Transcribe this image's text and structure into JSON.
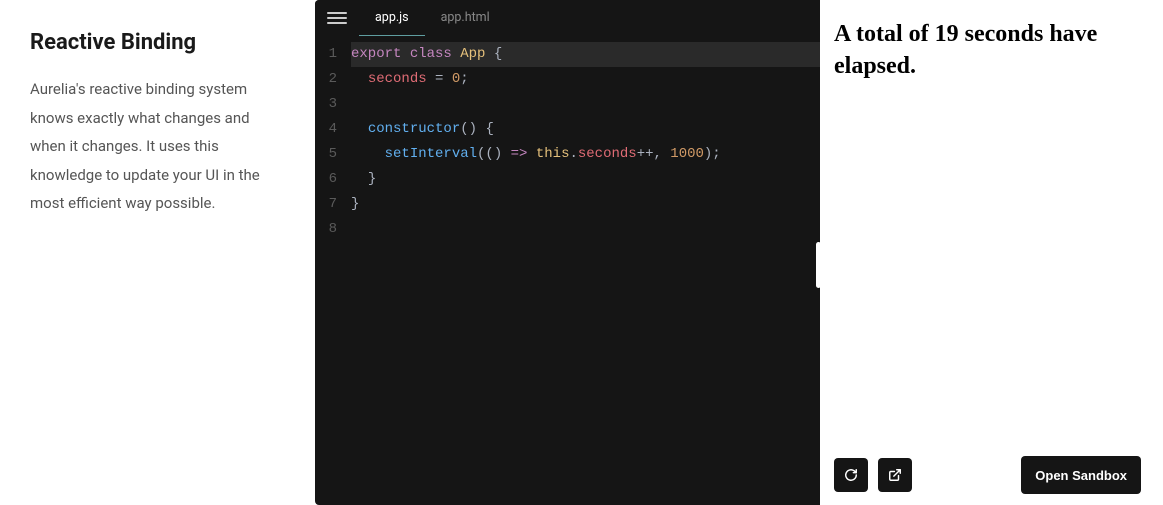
{
  "section": {
    "title": "Reactive Binding",
    "description": "Aurelia's reactive binding system knows exactly what changes and when it changes. It uses this knowledge to update your UI in the most efficient way possible."
  },
  "editor": {
    "tabs": [
      {
        "label": "app.js",
        "active": true
      },
      {
        "label": "app.html",
        "active": false
      }
    ],
    "line_numbers": [
      "1",
      "2",
      "3",
      "4",
      "5",
      "6",
      "7",
      "8"
    ],
    "code": {
      "l1": {
        "export": "export",
        "class": "class",
        "App": "App",
        "brace": " {"
      },
      "l2": {
        "indent": "  ",
        "seconds": "seconds",
        "eq": " = ",
        "zero": "0",
        "semi": ";"
      },
      "l3": "",
      "l4": {
        "indent": "  ",
        "constructor": "constructor",
        "parens": "()",
        "brace": " {"
      },
      "l5": {
        "indent": "    ",
        "setInterval": "setInterval",
        "open": "(() ",
        "arrow": "=>",
        "sp": " ",
        "this": "this",
        "dot": ".",
        "seconds": "seconds",
        "inc": "++, ",
        "num": "1000",
        "close": ");"
      },
      "l6": {
        "indent": "  ",
        "brace": "}"
      },
      "l7": {
        "brace": "}"
      },
      "l8": ""
    }
  },
  "preview": {
    "output_text": "A total of 19 seconds have elapsed.",
    "toolbar": {
      "open_sandbox_label": "Open Sandbox"
    }
  }
}
